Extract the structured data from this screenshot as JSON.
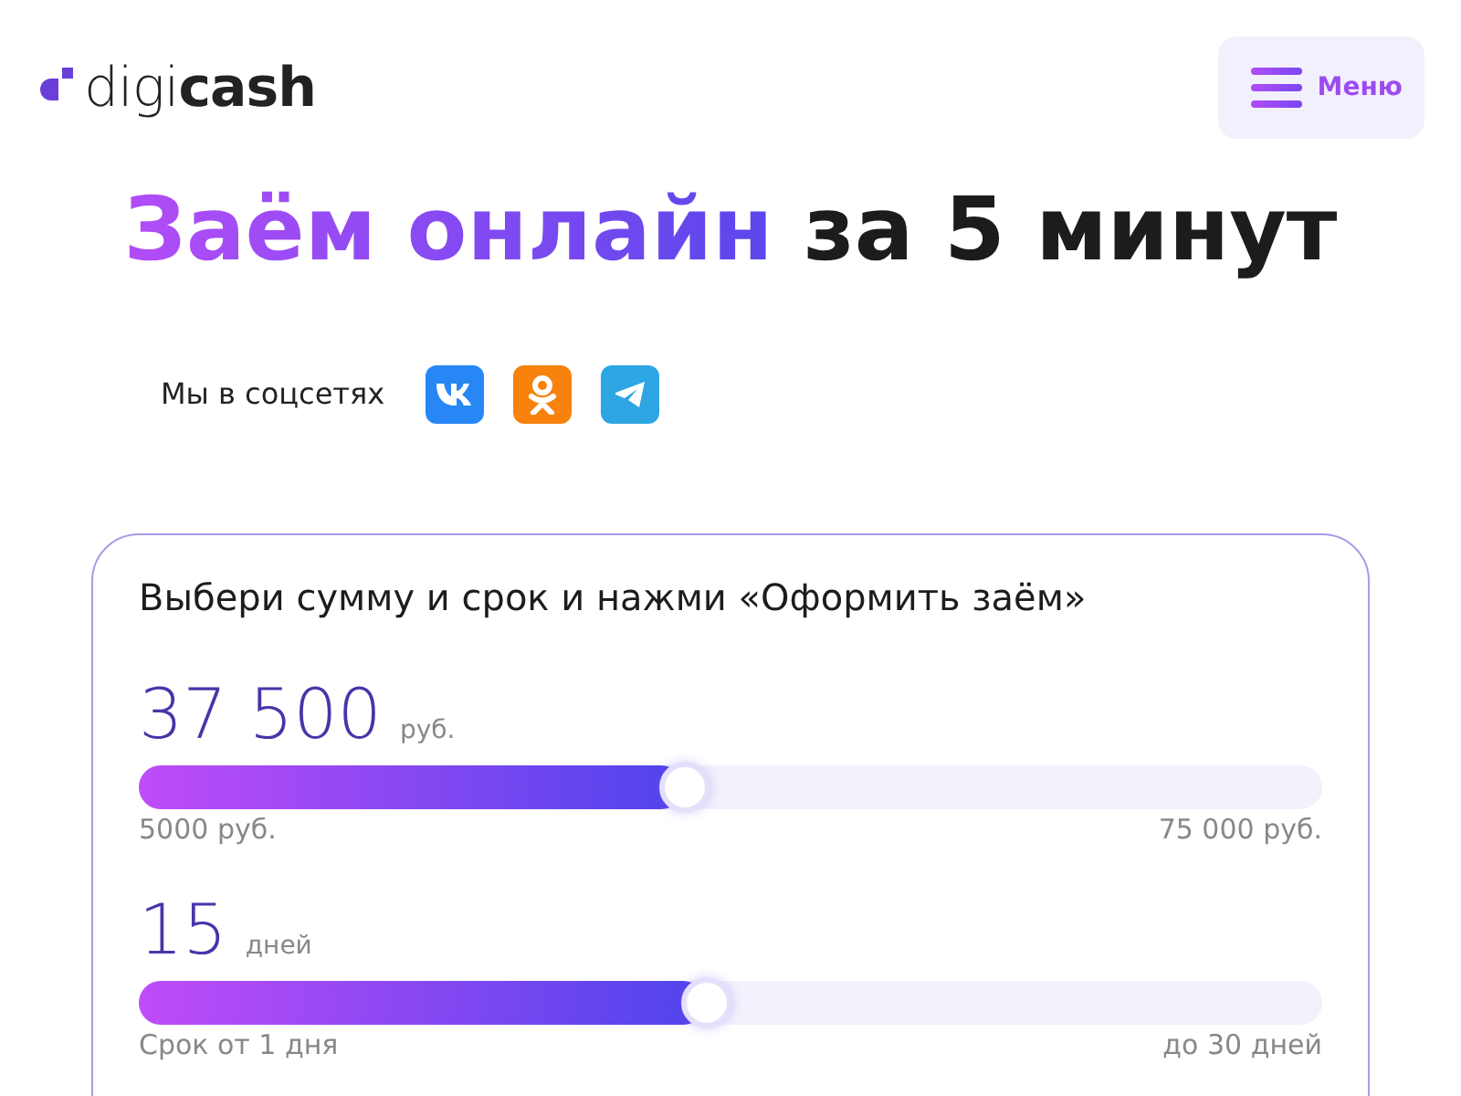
{
  "logo": {
    "text": "digi**cash**"
  },
  "menu_button": {
    "label": "Меню"
  },
  "heading": {
    "accent": "Заём онлайн",
    "rest": "за 5 минут"
  },
  "social": {
    "label": "Мы в соцсетях",
    "links": [
      {
        "kind": "vk"
      },
      {
        "kind": "ok"
      },
      {
        "kind": "telegram"
      }
    ]
  },
  "calculator": {
    "title": "Выбери сумму и срок и нажми «Оформить заём»",
    "sliders": [
      {
        "value": "37 500",
        "unit": "руб.",
        "level": 0.46,
        "min_label": "5000 руб.",
        "max_label": "75 000 руб."
      },
      {
        "value": "15",
        "unit": "дней",
        "level": 0.478,
        "min_label": "Срок от 1 дня",
        "max_label": "до 30 дней"
      }
    ]
  }
}
